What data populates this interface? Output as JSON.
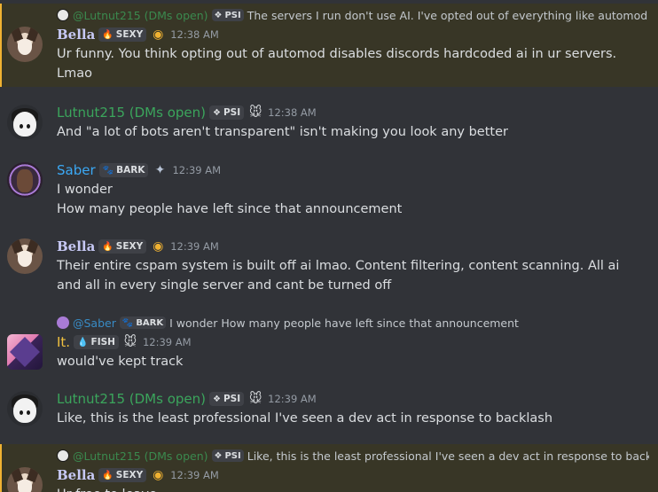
{
  "colors": {
    "bella": "#c7c9f5",
    "lutnut": "#3ba55c",
    "saber": "#3ba9f5",
    "it": "#f0c040",
    "highlight_bg": "#383626",
    "highlight_bar": "#f0b232"
  },
  "messages": [
    {
      "reply": {
        "author": "@Lutnut215 (DMs open)",
        "tag": "PSI",
        "text": "The servers I run don't use AI. I've opted out of everything like automod"
      },
      "author": "Bella",
      "tag": "SEXY",
      "timestamp": "12:38 AM",
      "lines": [
        "Ur funny. You think opting out of automod disables discords hardcoded ai in ur servers. Lmao"
      ]
    },
    {
      "author": "Lutnut215 (DMs open)",
      "tag": "PSI",
      "timestamp": "12:38 AM",
      "lines": [
        "And \"a lot of bots aren't transparent\" isn't making you look any better"
      ]
    },
    {
      "author": "Saber",
      "tag": "BARK",
      "timestamp": "12:39 AM",
      "lines": [
        "I wonder",
        "How many people have left since that announcement"
      ]
    },
    {
      "author": "Bella",
      "tag": "SEXY",
      "timestamp": "12:39 AM",
      "lines": [
        "Their entire cspam system is built off ai lmao. Content filtering, content scanning. All ai and all in every single server and cant be turned off"
      ]
    },
    {
      "reply": {
        "author": "@Saber",
        "tag": "BARK",
        "text": "I wonder How many people have left since that announcement"
      },
      "author": "It.",
      "tag": "FISH",
      "timestamp": "12:39 AM",
      "lines": [
        "would've kept track"
      ]
    },
    {
      "author": "Lutnut215 (DMs open)",
      "tag": "PSI",
      "timestamp": "12:39 AM",
      "lines": [
        "Like, this is the least professional I've seen a dev act in response to backlash"
      ]
    },
    {
      "reply": {
        "author": "@Lutnut215 (DMs open)",
        "tag": "PSI",
        "text": "Like, this is the least professional I've seen a dev act in response to backlash"
      },
      "author": "Bella",
      "tag": "SEXY",
      "timestamp": "12:39 AM",
      "lines": [
        "Ur free to leave."
      ]
    }
  ]
}
